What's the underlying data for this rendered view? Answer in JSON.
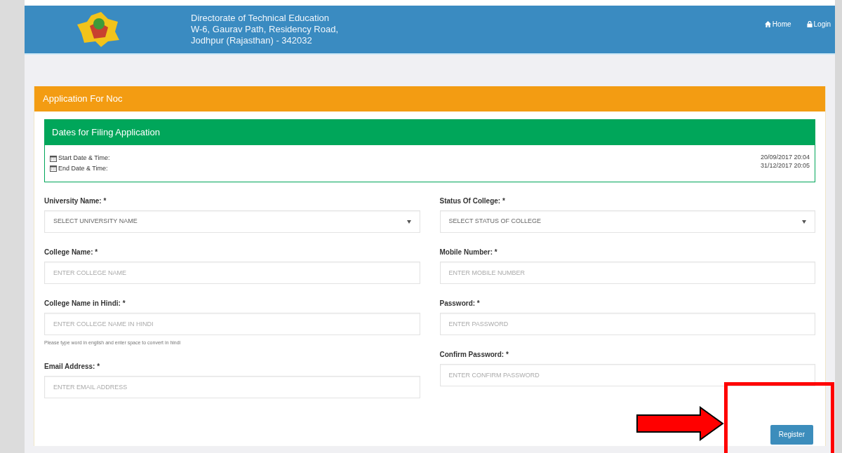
{
  "header": {
    "lines": [
      "Directorate of Technical Education",
      "W-6, Gaurav Path, Residency Road,",
      "Jodhpur (Rajasthan) - 342032"
    ],
    "nav": [
      {
        "kind": "home",
        "label": "Home"
      },
      {
        "kind": "login",
        "label": "Login"
      }
    ]
  },
  "panel": {
    "title": "Application For Noc",
    "dates": {
      "title": "Dates for Filing Application",
      "rows": [
        {
          "label": "Start Date & Time:",
          "value": "20/09/2017 20:04"
        },
        {
          "label": "End Date & Time:",
          "value": "31/12/2017 20:05"
        }
      ]
    },
    "columns": [
      [
        {
          "kind": "select",
          "label": "University Name: *",
          "placeholder": "SELECT UNIVERSITY NAME"
        },
        {
          "kind": "input",
          "label": "College Name: *",
          "placeholder": "ENTER COLLEGE NAME"
        },
        {
          "kind": "input",
          "label": "College Name in Hindi: *",
          "placeholder": "ENTER COLLEGE NAME IN HINDI",
          "help": "Please type word in english and enter space to convert in hindi"
        },
        {
          "kind": "input",
          "label": "Email Address: *",
          "placeholder": "ENTER EMAIL ADDRESS"
        }
      ],
      [
        {
          "kind": "select",
          "label": "Status Of College: *",
          "placeholder": "SELECT STATUS OF COLLEGE"
        },
        {
          "kind": "input",
          "label": "Mobile Number: *",
          "placeholder": "ENTER MOBILE NUMBER"
        },
        {
          "kind": "input",
          "label": "Password: *",
          "placeholder": "ENTER PASSWORD"
        },
        {
          "kind": "input",
          "label": "Confirm Password: *",
          "placeholder": "ENTER CONFIRM PASSWORD"
        }
      ]
    ],
    "submit": "Register"
  }
}
